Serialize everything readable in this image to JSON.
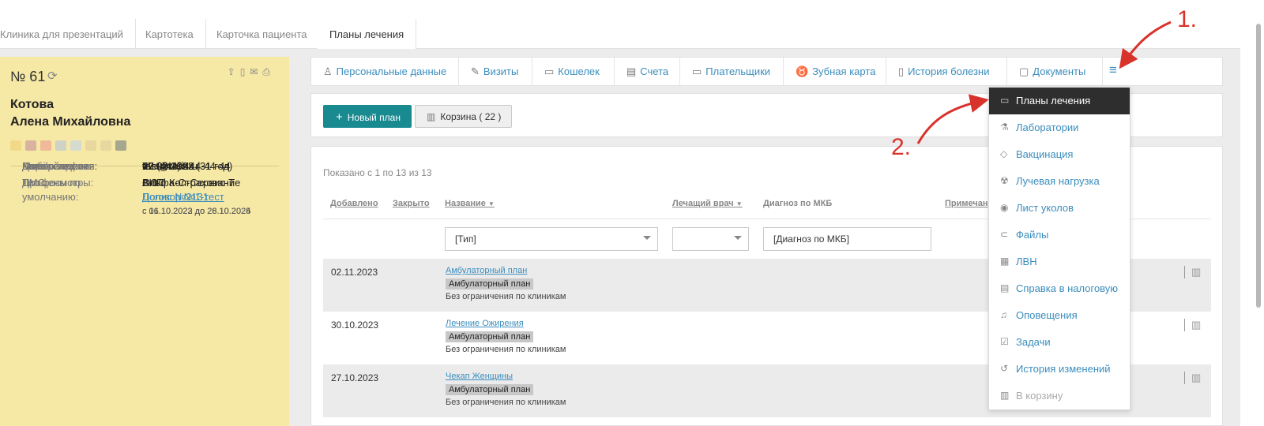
{
  "breadcrumbs": [
    "Клиника для презентаций",
    "Картотека",
    "Карточка пациента",
    "Планы лечения"
  ],
  "patient": {
    "number": "№ 61",
    "name_line1": "Котова",
    "name_line2": "Алена Михайловна",
    "swatch_colors": [
      "#f2d98a",
      "#d9b3a0",
      "#f0b99a",
      "#cfd3c7",
      "#d6dbd0",
      "#e8d8a0",
      "#e8d8a0",
      "#a5a88e"
    ],
    "fields": [
      {
        "k": "Дата рождения:",
        "v": "12.02.1992 (31 год)"
      },
      {
        "k": "Пол:",
        "v": "Женский"
      },
      {
        "k": "Моб. телефон:",
        "v": "+7 (444) 444-44-44"
      },
      {
        "k": "Email:",
        "v": "test@test.ru"
      },
      {
        "k": "Первый визит:",
        "v": "02.08.2023"
      },
      {
        "k": "Кол-во визитов:",
        "v": "77"
      }
    ],
    "price_type_label": "Тип цены по умолчанию:",
    "price_type_value": "ВИП",
    "dms_label": "ДМС:",
    "dms_company": "Альфа-Страхование",
    "dms_policy": "Полис №2131",
    "dms_dates": "с 16.10.2023 до 28.10.2025",
    "prof_label": "Профосмотры:",
    "prof_company": "ООО Кол-Сервис-Т",
    "prof_contract": "Договор №1-тест",
    "prof_dates": "с 01.10.2022 до 26.10.2024"
  },
  "nav": [
    "Персональные данные",
    "Визиты",
    "Кошелек",
    "Счета",
    "Плательщики",
    "Зубная карта",
    "История болезни",
    "Документы"
  ],
  "toolbar": {
    "new_plan": "Новый план",
    "trash": "Корзина ( 22 )"
  },
  "table": {
    "shown": "Показано с 1 по 13 из 13",
    "headers": {
      "added": "Добавлено",
      "closed": "Закрыто",
      "name": "Название",
      "doctor": "Лечащий врач",
      "diagnosis": "Диагноз по МКБ",
      "note": "Примечан"
    },
    "filters": {
      "type": "[Тип]",
      "doctor": "",
      "diagnosis": "[Диагноз по МКБ]"
    },
    "rows": [
      {
        "date": "02.11.2023",
        "title": "Амбулаторный план",
        "badge": "Амбулаторный план",
        "note": "Без ограничения по клиникам"
      },
      {
        "date": "30.10.2023",
        "title": "Лечение Ожирения",
        "badge": "Амбулаторный план",
        "note": "Без ограничения по клиникам"
      },
      {
        "date": "27.10.2023",
        "title": "Чекап Женщины",
        "badge": "Амбулаторный план",
        "note": "Без ограничения по клиникам"
      }
    ]
  },
  "menu": [
    "Планы лечения",
    "Лаборатории",
    "Вакцинация",
    "Лучевая нагрузка",
    "Лист уколов",
    "Файлы",
    "ЛВН",
    "Справка в налоговую",
    "Оповещения",
    "Задачи",
    "История изменений",
    "В корзину"
  ],
  "annotations": {
    "one": "1.",
    "two": "2."
  },
  "colors": {
    "accent": "#1a8a91",
    "link": "#3b8dbd",
    "card": "#f6e8a5",
    "annotation": "#d9322b"
  }
}
